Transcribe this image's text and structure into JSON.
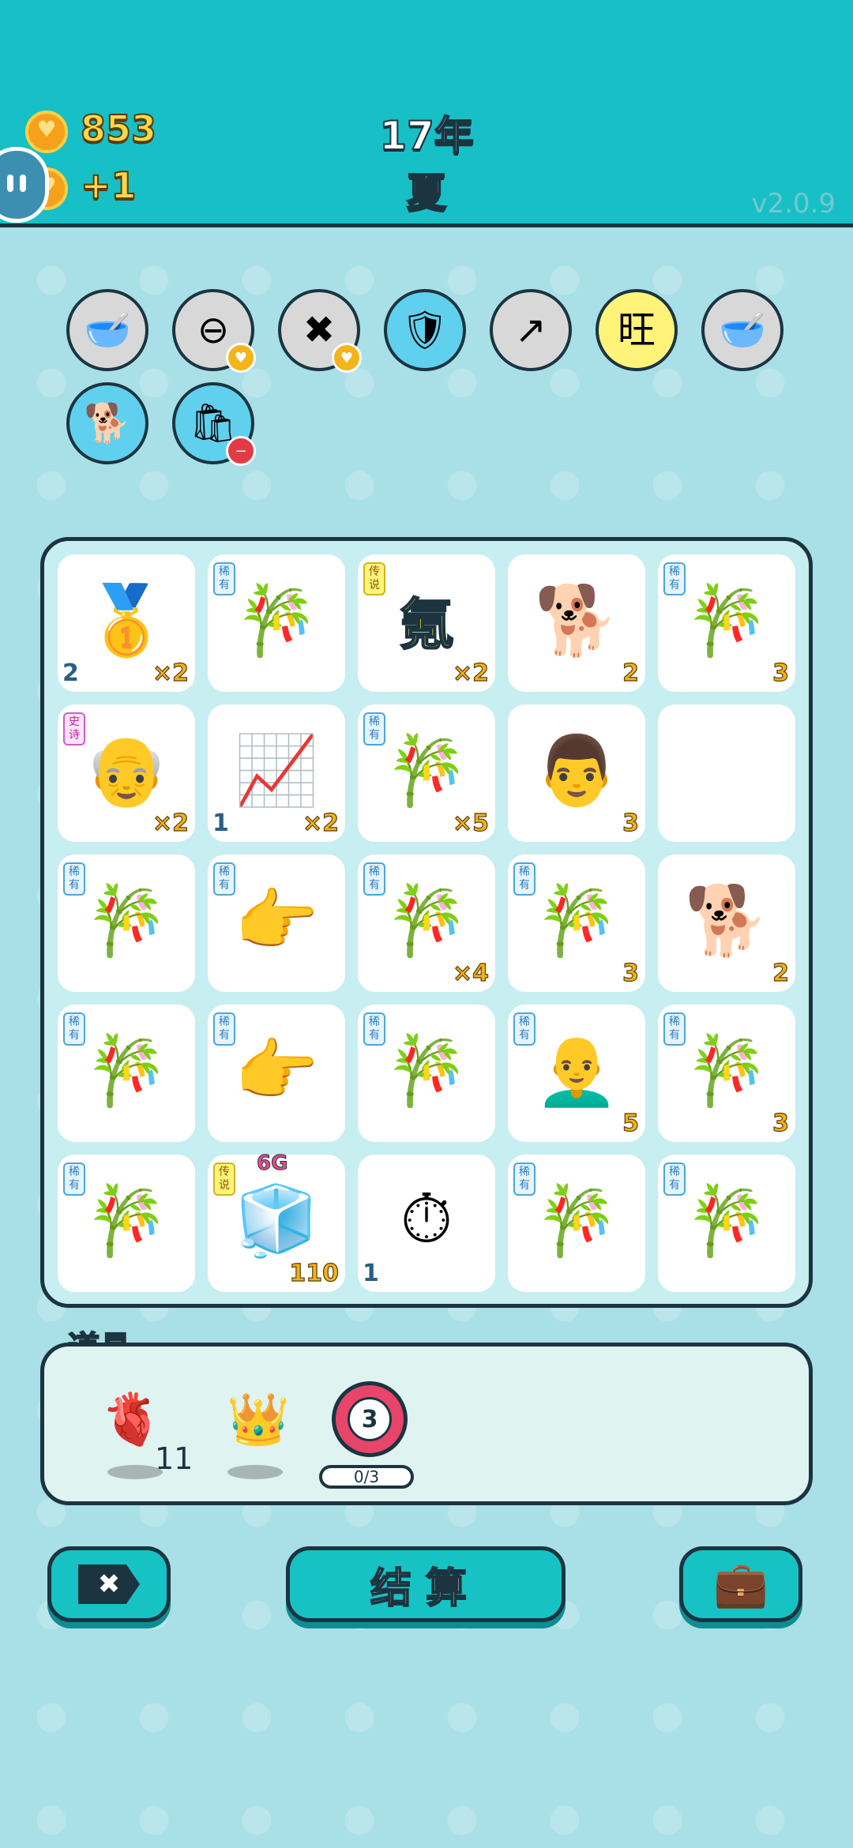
{
  "header": {
    "coins": "853",
    "coins_per_turn": "+1",
    "year": "17年",
    "season": "夏",
    "version": "v2.0.9"
  },
  "relics": [
    {
      "name": "dog-food-bowl-icon",
      "glyph": "🥣",
      "bg": "#d8d8d8"
    },
    {
      "name": "remove-symbol-icon",
      "glyph": "⊖",
      "bg": "#d8d8d8",
      "badge": "♥"
    },
    {
      "name": "delete-tag-icon",
      "glyph": "✖",
      "bg": "#d8d8d8",
      "badge": "♥"
    },
    {
      "name": "shield-wrench-icon",
      "glyph": "🛡",
      "bg": "#5fd0ee"
    },
    {
      "name": "curved-arrow-icon",
      "glyph": "↗",
      "bg": "#d8d8d8"
    },
    {
      "name": "wang-characters-icon",
      "glyph": "旺",
      "bg": "#fff37a"
    },
    {
      "name": "dog-food-bowl-icon",
      "glyph": "🥣",
      "bg": "#d8d8d8"
    },
    {
      "name": "shiba-dog-icon",
      "glyph": "🐕",
      "bg": "#5fd0ee"
    },
    {
      "name": "sack-icon",
      "glyph": "🛍",
      "bg": "#5fd0ee",
      "badge": "−",
      "badge_red": true
    }
  ],
  "board": [
    [
      {
        "icon": "gold-bars-icon",
        "glyph": "🥇",
        "left": "2",
        "right": "×2"
      },
      {
        "icon": "bamboo-icon",
        "glyph": "🎋",
        "tag": "稀有",
        "tag_type": "rare"
      },
      {
        "icon": "krypton-icon",
        "glyph": "氪",
        "tag": "传说",
        "tag_type": "legend",
        "right": "×2"
      },
      {
        "icon": "husky-dog-icon",
        "glyph": "🐕",
        "right": "2"
      },
      {
        "icon": "bamboo-icon",
        "glyph": "🎋",
        "tag": "稀有",
        "tag_type": "rare",
        "right": "3"
      }
    ],
    [
      {
        "icon": "old-man-face-icon",
        "glyph": "👴",
        "tag": "史诗",
        "tag_type": "epic",
        "right": "×2"
      },
      {
        "icon": "trend-chart-icon",
        "glyph": "📈",
        "left": "1",
        "right": "×2"
      },
      {
        "icon": "bamboo-icon",
        "glyph": "🎋",
        "tag": "稀有",
        "tag_type": "rare",
        "right": "×5"
      },
      {
        "icon": "man-face-icon",
        "glyph": "👨",
        "right": "3"
      },
      {
        "icon": "empty-slot",
        "glyph": ""
      }
    ],
    [
      {
        "icon": "bamboo-icon",
        "glyph": "🎋",
        "tag": "稀有",
        "tag_type": "rare"
      },
      {
        "icon": "pointing-finger-icon",
        "glyph": "👉",
        "tag": "稀有",
        "tag_type": "rare"
      },
      {
        "icon": "bamboo-icon",
        "glyph": "🎋",
        "tag": "稀有",
        "tag_type": "rare",
        "right": "×4"
      },
      {
        "icon": "bamboo-icon",
        "glyph": "🎋",
        "tag": "稀有",
        "tag_type": "rare",
        "right": "3"
      },
      {
        "icon": "husky-dog-icon",
        "glyph": "🐕",
        "right": "2"
      }
    ],
    [
      {
        "icon": "bamboo-icon",
        "glyph": "🎋",
        "tag": "稀有",
        "tag_type": "rare"
      },
      {
        "icon": "pointing-finger-icon",
        "glyph": "👉",
        "tag": "稀有",
        "tag_type": "rare"
      },
      {
        "icon": "bamboo-icon",
        "glyph": "🎋",
        "tag": "稀有",
        "tag_type": "rare"
      },
      {
        "icon": "bald-man-face-icon",
        "glyph": "👨‍🦲",
        "tag": "稀有",
        "tag_type": "rare",
        "right": "5"
      },
      {
        "icon": "bamboo-icon",
        "glyph": "🎋",
        "tag": "稀有",
        "tag_type": "rare",
        "right": "3"
      }
    ],
    [
      {
        "icon": "bamboo-icon",
        "glyph": "🎋",
        "tag": "稀有",
        "tag_type": "rare"
      },
      {
        "icon": "fridge-6g-icon",
        "glyph": "🧊",
        "tag": "传说",
        "tag_type": "legend",
        "top": "6G",
        "right": "110"
      },
      {
        "icon": "stopwatch-icon",
        "glyph": "⏱",
        "left": "1"
      },
      {
        "icon": "bamboo-icon",
        "glyph": "🎋",
        "tag": "稀有",
        "tag_type": "rare"
      },
      {
        "icon": "bamboo-icon",
        "glyph": "🎋",
        "tag": "稀有",
        "tag_type": "rare"
      }
    ]
  ],
  "props": {
    "title": "道具",
    "liver_count": "11",
    "target_number": "3",
    "target_progress": "0/3"
  },
  "buttons": {
    "settle": "结算"
  }
}
